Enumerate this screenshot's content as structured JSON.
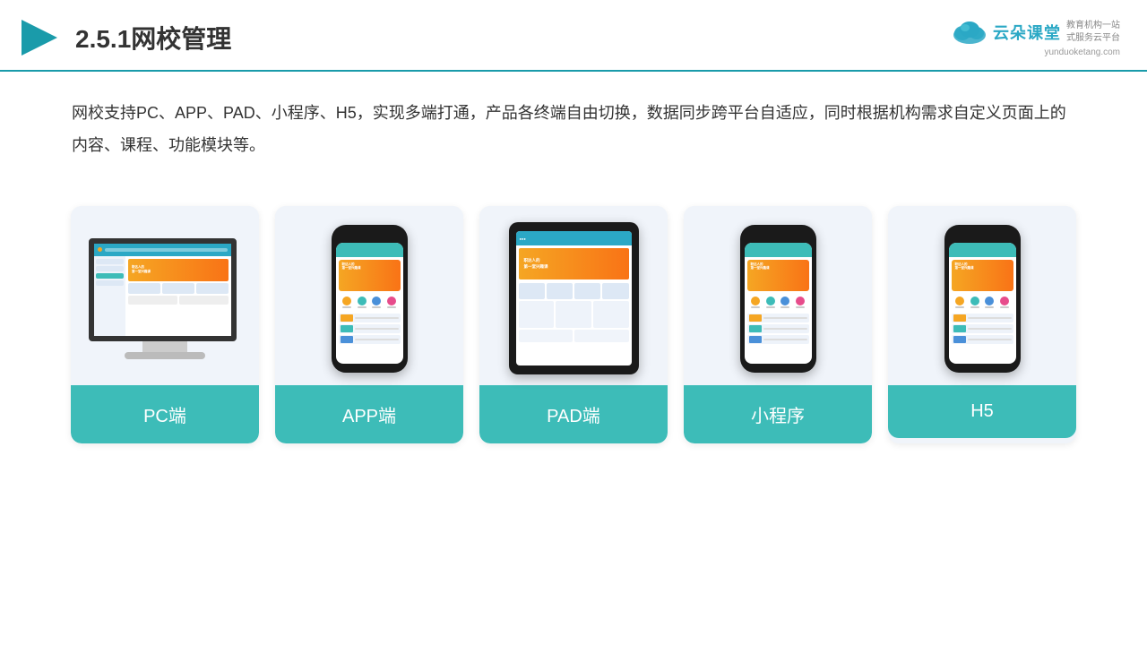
{
  "header": {
    "title": "2.5.1网校管理",
    "logo_name": "云朵课堂",
    "logo_url": "yunduoketang.com",
    "logo_tagline_line1": "教育机构一站",
    "logo_tagline_line2": "式服务云平台"
  },
  "description": {
    "text": "网校支持PC、APP、PAD、小程序、H5，实现多端打通，产品各终端自由切换，数据同步跨平台自适应，同时根据机构需求自定义页面上的内容、课程、功能模块等。"
  },
  "cards": [
    {
      "id": "pc",
      "label": "PC端",
      "type": "desktop"
    },
    {
      "id": "app",
      "label": "APP端",
      "type": "phone"
    },
    {
      "id": "pad",
      "label": "PAD端",
      "type": "tablet"
    },
    {
      "id": "miniprogram",
      "label": "小程序",
      "type": "phone"
    },
    {
      "id": "h5",
      "label": "H5",
      "type": "phone"
    }
  ],
  "colors": {
    "accent": "#3dbcb8",
    "header_line": "#1a9baa",
    "card_bg": "#f0f4fa",
    "title_color": "#333333"
  }
}
